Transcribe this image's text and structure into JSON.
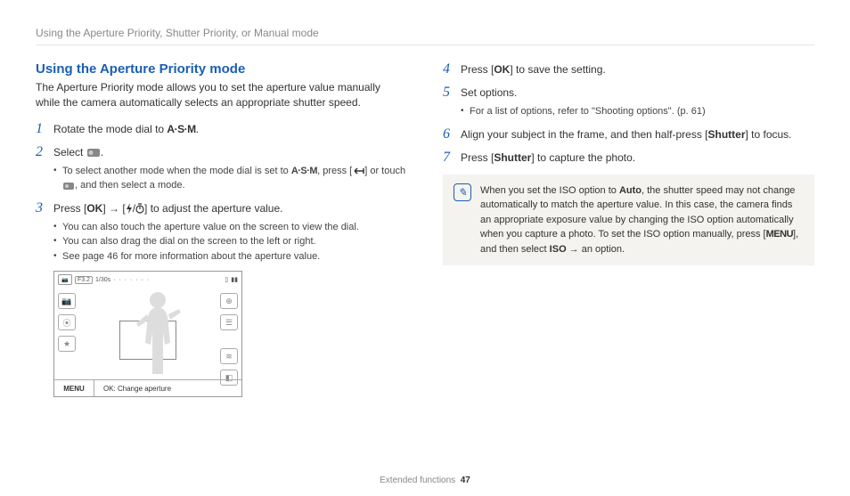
{
  "header": "Using the Aperture Priority, Shutter Priority, or Manual mode",
  "title": "Using the Aperture Priority mode",
  "intro": "The Aperture Priority mode allows you to set the aperture value manually while the camera automatically selects an appropriate shutter speed.",
  "step1_a": "Rotate the mode dial to ",
  "step1_b": ".",
  "step2_a": "Select ",
  "step2_b": ".",
  "step2_sub_a": "To select another mode when the mode dial is set to ",
  "step2_sub_b": ", press [",
  "step2_sub_c": "] or touch ",
  "step2_sub_d": ", and then select a mode.",
  "step3_a": "Press [",
  "step3_b": "] → [",
  "step3_c": "/",
  "step3_d": "] to adjust the aperture value.",
  "step3_sub1": "You can also touch the aperture value on the screen to view the dial.",
  "step3_sub2": "You can also drag the dial on the screen to the left or right.",
  "step3_sub3": "See page 46 for more information about the aperture value.",
  "lcd": {
    "f_value": "F3.2",
    "shutter": "1/30s",
    "menu": "MENU",
    "msg": "OK: Change aperture"
  },
  "step4_a": "Press [",
  "step4_b": "] to save the setting.",
  "step5": "Set options.",
  "step5_sub": "For a list of options, refer to \"Shooting options\". (p. 61)",
  "step6_a": "Align your subject in the frame, and then half-press [",
  "step6_b": "Shutter",
  "step6_c": "] to focus.",
  "step7_a": "Press [",
  "step7_b": "Shutter",
  "step7_c": "] to capture the photo.",
  "note_a": "When you set the ISO option to ",
  "note_auto": "Auto",
  "note_b": ", the shutter speed may not change automatically to match the aperture value. In this case, the camera finds an appropriate exposure value by changing the ISO option automatically when you capture a photo. To set the ISO option manually, press [",
  "note_c": "], and then select ",
  "note_iso": "ISO",
  "note_d": " → an option.",
  "ok_txt": "OK",
  "asm_txt": "A·S·M",
  "menu_txt": "MENU",
  "footer_section": "Extended functions",
  "footer_page": "47"
}
